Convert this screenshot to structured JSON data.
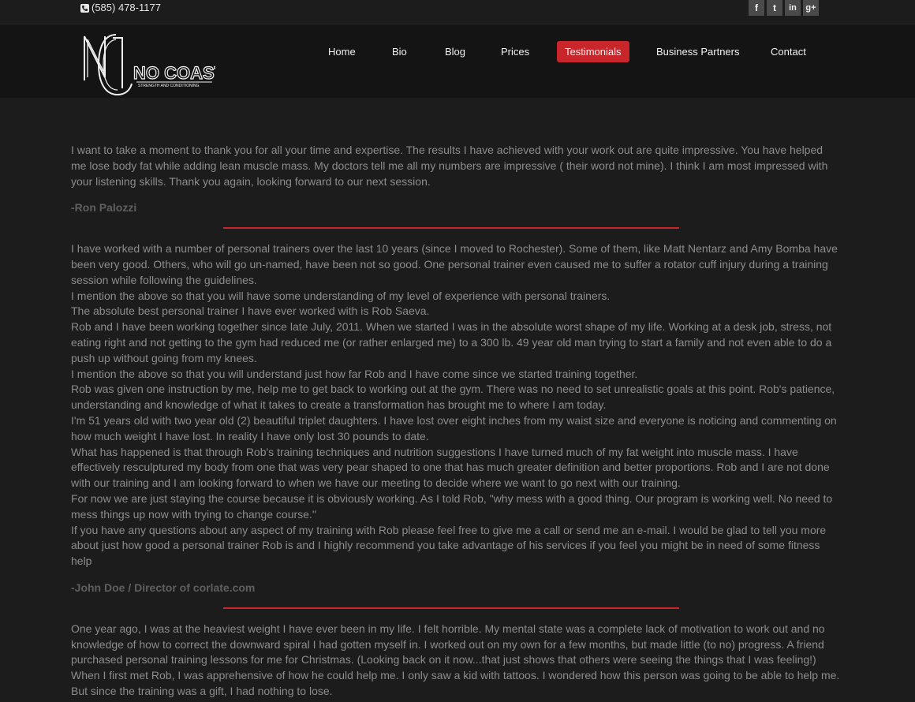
{
  "topbar": {
    "phone": "(585) 478-1177",
    "social": [
      {
        "icon": "facebook-icon",
        "glyph": "f"
      },
      {
        "icon": "twitter-icon",
        "glyph": "t"
      },
      {
        "icon": "linkedin-icon",
        "glyph": "in"
      },
      {
        "icon": "google-plus-icon",
        "glyph": "g+"
      }
    ]
  },
  "header": {
    "logo_text": "NO COAST",
    "logo_sub": "STRENGTH AND CONDITIONING",
    "logo_monogram": "NC"
  },
  "nav": {
    "items": [
      "Home",
      "Bio",
      "Blog",
      "Prices",
      "Testimonials",
      "Business Partners",
      "Contact"
    ],
    "active": "Testimonials"
  },
  "colors": {
    "accent": "#c9262b",
    "background": "#1c1c1c",
    "header": "#141414",
    "text": "#8c8c8c"
  },
  "testimonials": [
    {
      "paragraphs": [
        "I want to take a moment to thank you for all your time and expertise. The results I have achieved with your work out are quite impressive. You have helped me lose body fat while adding lean muscle mass. My doctors tell me all my numbers are impressive ( their word not mine). I think I am most impressed with your listening skills. Thank you again, looking forward to our next session."
      ],
      "author": "-Ron Palozzi"
    },
    {
      "paragraphs": [
        "I have worked with a number of personal trainers over the last 10 years (since I moved to Rochester). Some of them, like Matt Nentarz and Amy Bomba have been very good. Others, who will go un-named, have been not so good. One personal trainer even caused me to suffer a rotator cuff injury during a training session while following the guidelines.",
        "I mention the above so that you will have some understanding of my level of experience with personal trainers.",
        "The absolute best personal trainer I have ever worked with is Rob Saeva.",
        "Rob and I have been working together since late July, 2011. When we started I was in the absolute worst shape of my life. Working at a desk job, stress, not eating right and not getting to the gym had reduced me (or rather enlarged me) to a 300 lb. 49 year old man trying to start a family and not even able to do a push up without going from my knees.",
        "I mention the above so that you will understand just how far Rob and I have come since we started training together.",
        "Rob was given one instruction by me, help me to get back to working out at the gym. There was no need to set unrealistic goals at this point. Rob's patience, understanding and knowledge of what it takes to create a transformation has brought me to where I am today.",
        "I'm 51 years old with two year old (2) beautiful triplet daughters. I have lost over eight inches from my waist size and everyone is noticing and commenting on how much weight I have lost. In reality I have only lost 30 pounds to date.",
        "What has happened is that through Rob's training techniques and nutrition suggestions I have turned much of my fat weight into muscle mass. I have effectively resculptured my body from one that was very pear shaped to one that has much greater definition and better proportions. Rob and I are not done with our training and I am looking forward to when we have our meeting to decide where we want to go next with our training.",
        "For now we are just staying the course because it is obviously working. As I told Rob, \"why mess with a good thing. Our program is working well. No need to mess things up now with trying to change course.\"",
        "If you have any questions about any aspect of my training with Rob please feel free to give me a call or send me an e-mail. I would be glad to tell you more about just how good a personal trainer Rob is and I highly recommend you take advantage of his services if you feel you might be in need of some fitness help"
      ],
      "author": "-John Doe / Director of corlate.com"
    },
    {
      "paragraphs": [
        "One year ago, I was at the heaviest weight I have ever been in my life. I felt horrible. My mental state was a complete lack of motivation to work out and no knowledge of how to correct the downward spiral I had gotten myself in. I worked out on my own for a few months, but made little (to no) progress. A friend purchased personal training lessons for me for Christmas. (Looking back on it now...that just shows that others were seeing the things that I was feeling!)",
        "When I first met Rob, I was apprehensive of how he could help me. I only saw a kid with tattoos. I wondered how this person was going to be able to help me. But since the training was a gift, I had nothing to lose."
      ],
      "author": ""
    }
  ]
}
